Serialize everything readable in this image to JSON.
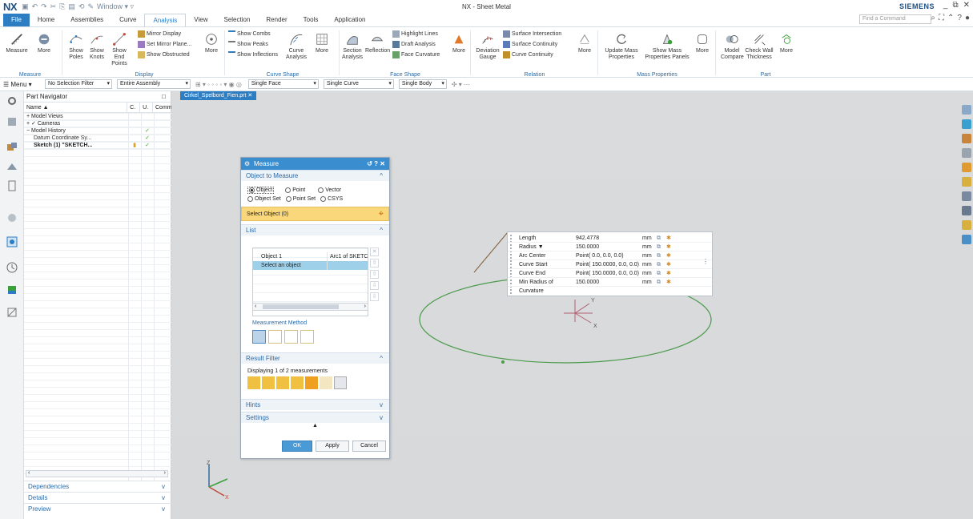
{
  "window": {
    "app_logo": "NX",
    "title": "NX - Sheet Metal",
    "brand": "SIEMENS",
    "window_menu": "Window ▾ ▿",
    "controls": [
      "_",
      "⧉",
      "✕"
    ]
  },
  "tabs": [
    "File",
    "Home",
    "Assemblies",
    "Curve",
    "Analysis",
    "View",
    "Selection",
    "Render",
    "Tools",
    "Application"
  ],
  "active_tab": "Analysis",
  "command_finder": {
    "placeholder": "Find a Command"
  },
  "ribbon": {
    "measure": {
      "measure": "Measure",
      "more": "More",
      "group": "Measure"
    },
    "display": {
      "show_poles": "Show Poles",
      "show_knots": "Show Knots",
      "show_end_points": "Show End Points",
      "mirror_display": "Mirror Display",
      "set_mirror_plane": "Set Mirror Plane...",
      "show_obstructed": "Show Obstructed",
      "more": "More",
      "group": "Display"
    },
    "curve_shape": {
      "show_combs": "Show Combs",
      "show_peaks": "Show Peaks",
      "show_inflections": "Show Inflections",
      "curve_analysis": "Curve Analysis",
      "more": "More",
      "group": "Curve Shape"
    },
    "face_shape": {
      "section_analysis": "Section Analysis",
      "reflection": "Reflection",
      "highlight_lines": "Highlight Lines",
      "draft_analysis": "Draft Analysis",
      "face_curvature": "Face Curvature",
      "more": "More",
      "group": "Face Shape"
    },
    "relation": {
      "deviation_gauge": "Deviation Gauge",
      "surface_intersection": "Surface Intersection",
      "surface_continuity": "Surface Continuity",
      "curve_continuity": "Curve Continuity",
      "more": "More",
      "group": "Relation"
    },
    "mass_properties": {
      "update_mass_properties": "Update Mass Properties",
      "show_mass_properties_panels": "Show Mass Properties Panels",
      "more": "More",
      "group": "Mass Properties"
    },
    "part": {
      "model_compare": "Model Compare",
      "check_wall_thickness": "Check Wall Thickness",
      "more": "More",
      "group": "Part"
    }
  },
  "selection_bar": {
    "menu": "☰ Menu ▾",
    "filter": "No Selection Filter",
    "scope": "Entire Assembly",
    "face_rule": "Single Face",
    "curve_rule": "Single Curve",
    "body_rule": "Single Body"
  },
  "navigator": {
    "title": "Part Navigator",
    "columns": [
      "Name ▲",
      "C.",
      "U.",
      "Comm"
    ],
    "rows": [
      {
        "name": "+ Model Views",
        "c": "",
        "u": ""
      },
      {
        "name": "+ ✓ Cameras",
        "c": "",
        "u": ""
      },
      {
        "name": "− Model History",
        "c": "",
        "u": "✓"
      },
      {
        "name": "   Datum Coordinate Sy...",
        "c": "",
        "u": "✓"
      },
      {
        "name": "   Sketch (1) \"SKETCH...",
        "c": "▮",
        "u": "✓"
      }
    ],
    "panels": [
      "Dependencies",
      "Details",
      "Preview"
    ]
  },
  "document_tab": "Cirkel_Spelbord_Fien.prt",
  "measure_dialog": {
    "title": "Measure",
    "title_controls": "↺ ? ✕",
    "object_section": "Object to Measure",
    "radio_options": [
      "Object",
      "Point",
      "Vector",
      "Object Set",
      "Point Set",
      "CSYS"
    ],
    "selected_option": "Object",
    "select_object": "Select Object (0)",
    "list_section": "List",
    "list_rows": [
      {
        "a": "Object 1",
        "b": "Arc1 of SKETC"
      },
      {
        "a": "Select an object",
        "b": ""
      }
    ],
    "measurement_method": "Measurement Method",
    "result_filter_section": "Result Filter",
    "result_filter_desc": "Displaying 1 of 2 measurements",
    "hints": "Hints",
    "settings": "Settings",
    "ok": "OK",
    "apply": "Apply",
    "cancel": "Cancel"
  },
  "results": [
    {
      "label": "Length",
      "value": "942.4778",
      "unit": "mm"
    },
    {
      "label": "Radius ▼",
      "value": "150.0000",
      "unit": "mm"
    },
    {
      "label": "Arc Center",
      "value": "Point( 0.0, 0.0, 0.0)",
      "unit": "mm"
    },
    {
      "label": "Curve Start",
      "value": "Point( 150.0000, 0.0, 0.0)",
      "unit": "mm"
    },
    {
      "label": "Curve End",
      "value": "Point( 150.0000, 0.0, 0.0)",
      "unit": "mm"
    },
    {
      "label": "Min Radius of Curvature",
      "value": "150.0000",
      "unit": "mm"
    }
  ],
  "axis_labels": {
    "x": "X",
    "y": "Y",
    "z": "Z"
  },
  "colors": {
    "accent": "#2d7dc3",
    "select_bar": "#f9d77a",
    "circle": "#4a9a4a",
    "graphics_bg": "#d8dadc"
  }
}
